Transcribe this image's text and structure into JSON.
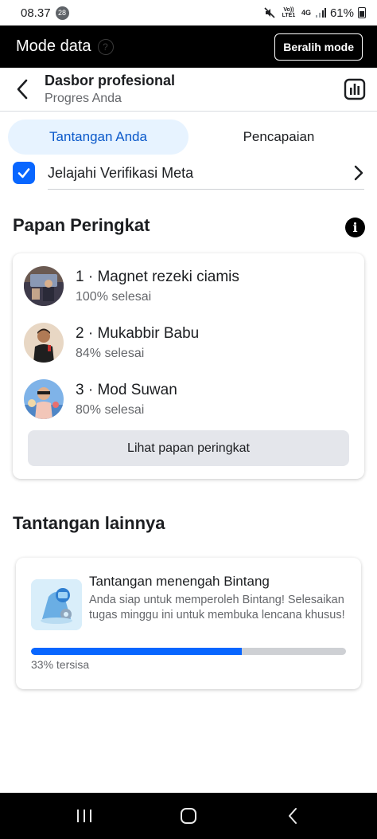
{
  "status_bar": {
    "time": "08.37",
    "notification_count": "28",
    "volte_label": "Vo)) LTE1",
    "network_label": "4G",
    "battery_percent": "61%"
  },
  "mode_bar": {
    "title": "Mode data",
    "help_glyph": "?",
    "switch_label": "Beralih mode"
  },
  "header": {
    "title": "Dasbor profesional",
    "subtitle": "Progres Anda"
  },
  "tabs": [
    {
      "label": "Tantangan Anda",
      "active": true
    },
    {
      "label": "Pencapaian",
      "active": false
    }
  ],
  "verification": {
    "label": "Jelajahi Verifikasi Meta",
    "checked": true
  },
  "leaderboard": {
    "title": "Papan Peringkat",
    "info_glyph": "i",
    "entries": [
      {
        "name": "1 · Magnet rezeki ciamis",
        "progress": "100% selesai"
      },
      {
        "name": "2 · Mukabbir Babu",
        "progress": "84% selesai"
      },
      {
        "name": "3 · Mod Suwan",
        "progress": "80% selesai"
      }
    ],
    "button_label": "Lihat papan peringkat"
  },
  "other_challenges": {
    "title": "Tantangan lainnya",
    "card": {
      "title": "Tantangan menengah Bintang",
      "description": "Anda siap untuk memperoleh Bintang! Selesaikan tugas minggu ini untuk membuka lencana khusus!",
      "progress_fraction": 0.67,
      "progress_label": "33% tersisa"
    }
  },
  "colors": {
    "accent": "#0866ff",
    "tab_active_bg": "#e7f3ff",
    "mode_bar_bg": "#000000"
  },
  "icons": [
    "back-arrow-icon",
    "bar-chart-icon",
    "checkmark-icon",
    "chevron-right-icon",
    "info-icon",
    "recent-apps-icon",
    "home-icon",
    "back-nav-icon"
  ]
}
